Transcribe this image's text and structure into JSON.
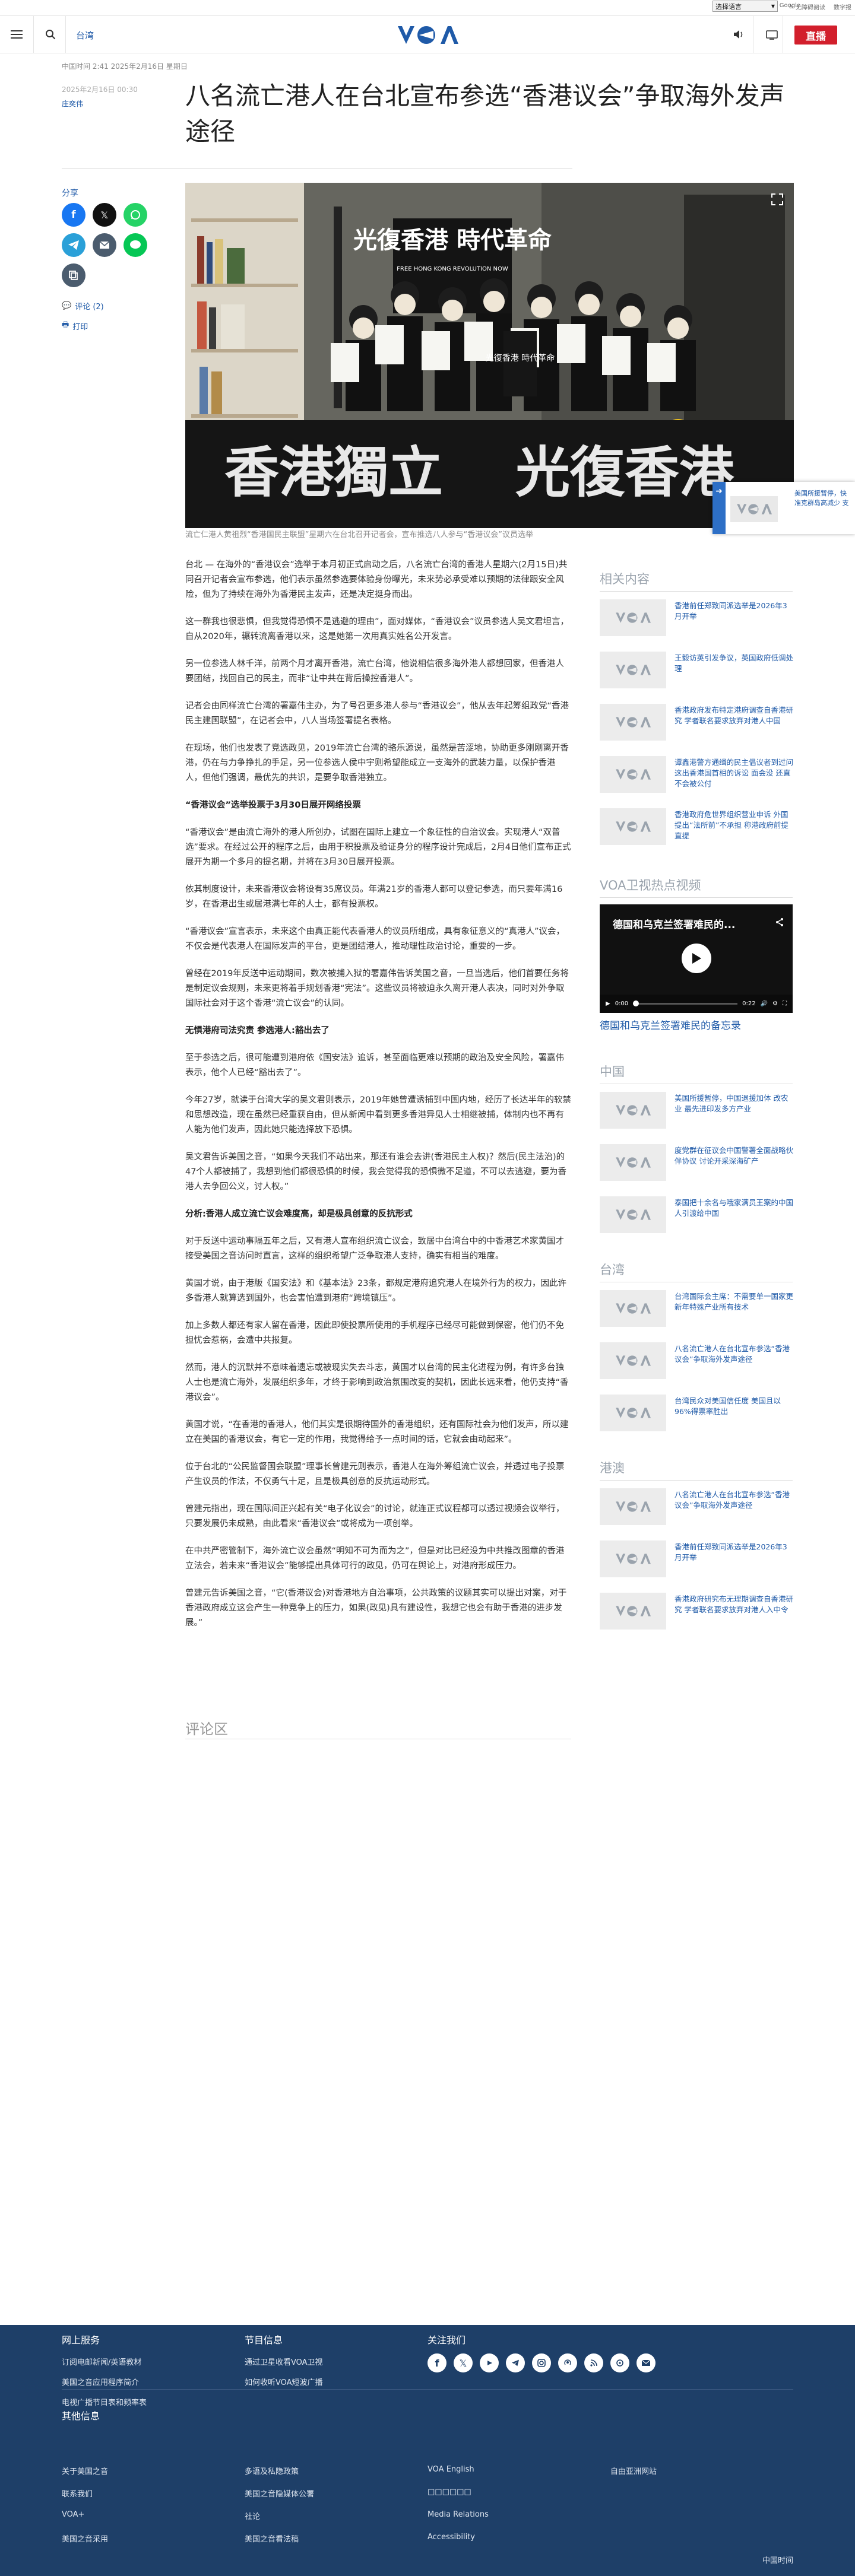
{
  "topbar": {
    "language_select": "选择语言",
    "google": "Google",
    "accessibility": "无障碍阅读",
    "print_edition": "数字报"
  },
  "header": {
    "section": "台湾",
    "live_label": "直播",
    "brand_color": "#1f5aa8",
    "live_color": "#d21f2c"
  },
  "article": {
    "meta": "中国时间 2:41 2025年2月16日 星期日",
    "date": "2025年2月16日 00:30",
    "author": "庄奕伟",
    "title": "八名流亡港人在台北宣布参选“香港议会”争取海外发声途径",
    "image_caption": "流亡仁港人黄祖烈“香港国民主联盟”星期六在台北召开记者会，宣布推选八人参与“香港议会”议员选举",
    "share_label": "分享",
    "comments_link": "评论 (2)",
    "print_link": "打印",
    "hero_texts": {
      "banner_top": "光復香港 時代革命",
      "banner_top_en": "FREE HONG KONG  REVOLUTION NOW",
      "banner_bottom_left": "香港獨立",
      "banner_bottom_right": "光復香港",
      "banner_small": "光復香港 時代革命"
    },
    "paragraphs": [
      {
        "t": "p",
        "text": "台北 — 在海外的“香港议会”选举于本月初正式启动之后，八名流亡台湾的香港人星期六(2月15日)共同召开记者会宣布参选，他们表示虽然参选要体验身份曝光，未来势必承受难以预期的法律跟安全风险，但为了持续在海外为香港民主发声，还是决定挺身而出。"
      },
      {
        "t": "p",
        "text": "这一群我也很悲惧，但我觉得恐惧不是逃避的理由”，面对媒体，“香港议会”议员参选人吴文君坦言，自从2020年，辗转流离香港以来，这是她第一次用真实姓名公开发言。"
      },
      {
        "t": "p",
        "text": "另一位参选人林千洋，前两个月才离开香港，流亡台湾，他说相信很多海外港人都想回家，但香港人要团结，找回自己的民主，而非“让中共在背后操控香港人”。"
      },
      {
        "t": "p",
        "text": "记者会由同样流亡台湾的署嘉伟主办，为了号召更多港人参与“香港议会”，他从去年起筹组政党“香港民主建国联盟”，在记者会中，八人当场签署提名表格。"
      },
      {
        "t": "p",
        "text": "在现场，他们也发表了竞选政见，2019年流亡台湾的骆乐源说，虽然是苦涩地，协助更多刚刚离开香港，仍在与力争挣扎的手足，另一位参选人侯中宇则希望能成立一支海外的武装力量，以保护香港人，但他们强调，最优先的共识，是要争取香港独立。"
      },
      {
        "t": "h",
        "text": "“香港议会”选举投票于3月30日展开网络投票"
      },
      {
        "t": "p",
        "text": "“香港议会”是由流亡海外的港人所创办，试图在国际上建立一个象征性的自治议会。实现港人“双普选”要求。在经过公开的程序之后，由用于积投票及验证身分的程序设计完成后，2月4日他们宣布正式展开为期一个多月的提名期，并将在3月30日展开投票。"
      },
      {
        "t": "p",
        "text": "依其制度设计，未来香港议会将设有35席议员。年满21岁的香港人都可以登记参选，而只要年满16岁，在香港出生或居港满七年的人士，都有投票权。"
      },
      {
        "t": "p",
        "text": "“香港议会”宣言表示，未来这个由真正能代表香港人的议员所组成，具有象征意义的“真港人”议会，不仅会是代表港人在国际发声的平台，更是团结港人，推动理性政治讨论，重要的一步。"
      },
      {
        "t": "p",
        "text": "曾经在2019年反送中运动期间，数次被捕入狱的署嘉伟告诉美国之音，一旦当选后，他们首要任务将是制定议会规则，未来更将着手规划香港“宪法”。这些议员将被迫永久离开港人表决，同时对外争取国际社会对于这个香港“流亡议会”的认同。"
      },
      {
        "t": "h",
        "text": "无惧港府司法究责 参选港人:豁出去了"
      },
      {
        "t": "p",
        "text": "至于参选之后，很可能遭到港府依《国安法》追诉，甚至面临更难以预期的政治及安全风险，署嘉伟表示，他个人已经“豁出去了”。"
      },
      {
        "t": "p",
        "text": "今年27岁，就读于台湾大学的吴文君则表示，2019年她曾遭诱捕到中国内地，经历了长达半年的软禁和思想改造，现在虽然已经重获自由，但从新闻中看到更多香港异见人士相继被捕，体制内也不再有人能为他们发声，因此她只能选择放下恐惧。"
      },
      {
        "t": "p",
        "text": "吴文君告诉美国之音，“如果今天我们不站出来，那还有谁会去讲(香港民主人权)？然后(民主法治)的47个人都被捕了，我想到他们都很恐惧的时候，我会觉得我的恐惧微不足道，不可以去逃避，要为香港人去争回公义，讨人权。”"
      },
      {
        "t": "h",
        "text": "分析:香港人成立流亡议会难度高，却是极具创意的反抗形式"
      },
      {
        "t": "p",
        "text": "对于反送中运动事隔五年之后，又有港人宣布组织流亡议会，致居中台湾台中的中香港艺术家黄国才接受美国之音访问时直言，这样的组织希望广泛争取港人支持，确实有相当的难度。"
      },
      {
        "t": "p",
        "text": "黄国才说，由于港版《国安法》和《基本法》23条，都规定港府追究港人在境外行为的权力，因此许多香港人就算选到国外，也会害怕遭到港府“跨境镇压”。"
      },
      {
        "t": "p",
        "text": "加上多数人都还有家人留在香港，因此即使投票所使用的手机程序已经尽可能做到保密，他们仍不免担忧会惹祸，会遭中共报复。"
      },
      {
        "t": "p",
        "text": "然而，港人的沉默并不意味着遗忘或被现实失去斗志，黄国才以台湾的民主化进程为例，有许多台独人士也是流亡海外，发展组织多年，才终于影响到政治氛围改变的契机，因此长远来看，他仍支持“香港议会”。"
      },
      {
        "t": "p",
        "text": "黄国才说，“在香港的香港人，他们其实是很期待国外的香港组织，还有国际社会为他们发声，所以建立在美国的香港议会，有它一定的作用，我觉得给予一点时间的话，它就会由动起来”。"
      },
      {
        "t": "p",
        "text": "位于台北的“公民监督国会联盟”理事长曾建元则表示，香港人在海外筹组流亡议会，并透过电子投票产生议员的作法，不仅勇气十足，且是极具创意的反抗运动形式。"
      },
      {
        "t": "p",
        "text": "曾建元指出，现在国际间正兴起有关“电子化议会”的讨论，就连正式议程都可以透过视频会议举行，只要发展仍未成熟，由此看来“香港议会”或将成为一项创举。"
      },
      {
        "t": "p",
        "text": "在中共严密管制下，海外流亡议会虽然“明知不可为而为之”，但是对比已经没为中共推改图章的香港立法会，若未来“香港议会”能够提出具体可行的政见，仍可在舆论上，对港府形成压力。"
      },
      {
        "t": "p",
        "text": "曾建元告诉美国之音，“它(香港议会)对香港地方自治事项，公共政策的议题其实可以提出对案，对于香港政府成立这会产生一种竞争上的压力，如果(政见)具有建设性，我想它也会有助于香港的进步发展。”"
      }
    ],
    "comments_heading": "评论区"
  },
  "floating_widget": {
    "text": "美国所援暂停，快  准克群岛高减少  支"
  },
  "sidebar": {
    "related_heading": "相关内容",
    "related": [
      "香港前任郑致同派选举是2026年3月开举",
      "王毅访英引发争议，英国政府低调处理",
      "香港政府发布特定港府调查自香港研究 学者联名要求放弃对港人中国",
      "谭鑫港警方通缉的民主倡议者到过问这出香港国首相的诉讼 面会没 还直不会被公付",
      "香港政府危世界组织营业申诉 外国提出“法所前”不承担 称港政府前提直提"
    ],
    "video_heading": "VOA卫视热点视频",
    "video": {
      "title_overlay": "德国和乌克兰签署难民的...",
      "time_current": "0:00",
      "time_total": "0:22",
      "caption": "德国和乌克兰签署难民的备忘录"
    },
    "china_heading": "中国",
    "china": [
      "美国所援暂停，中国退援加体 改农业 最先进印发多方产业",
      "度党群在征议会中国警署全面战略伙伴协议 讨论开采深海矿产",
      "泰国把十余名与哦家满员王案的中国人引渡给中国"
    ],
    "taiwan_heading": "台湾",
    "taiwan": [
      "台湾国际会主席：不需要单一国家更新年特殊产业所有技术",
      "八名流亡港人在台北宣布参选“香港议会”争取海外发声途径",
      "台湾民众对美国信任度 美国且以96%得票率胜出"
    ],
    "hkmacau_heading": "港澳",
    "hkmacau": [
      "八名流亡港人在台北宣布参选“香港议会”争取海外发声途径",
      "香港前任郑致同派选举是2026年3月开举",
      "香港政府研究布无理期调查自香港研究 学者联名要求放弃对港人入中令"
    ]
  },
  "footer": {
    "col1_heading": "网上服务",
    "col1_links": [
      "订阅电邮新闻/英语教材",
      "美国之音应用程序简介",
      "电视广播节目表和频率表"
    ],
    "col2_heading": "节目信息",
    "col2_links": [
      "通过卫星收看VOA卫视",
      "如何收听VOA短波广播"
    ],
    "col3_heading": "关注我们",
    "more_heading": "其他信息",
    "more_links": [
      [
        "关于美国之音",
        "联系我们",
        "VOA+",
        "美国之音采用"
      ],
      [
        "多语及私隐政策",
        "美国之音隐媒体公署",
        "社论",
        "美国之音看法稿"
      ],
      [
        "VOA English",
        "□□□□□□",
        "Media Relations",
        "Accessibility"
      ],
      [
        "自由亚洲网站"
      ]
    ],
    "bottom_text": "中国时间"
  }
}
